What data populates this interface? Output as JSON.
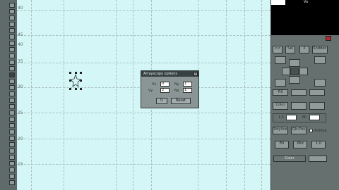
{
  "canvas": {
    "axis_labels": [
      "40",
      "45",
      "40",
      "35",
      "30",
      "25",
      "20",
      "15"
    ]
  },
  "dialog": {
    "title": "Arrayscopy options",
    "close_glyph": "×",
    "fields": [
      {
        "label": "Vx",
        "value": "0"
      },
      {
        "label": "Ny",
        "value": "1"
      },
      {
        "label": "Vy",
        "value": "2"
      },
      {
        "label": "Nx",
        "value": "1"
      }
    ],
    "ok_label": "Ü",
    "cancel_label": "Reset"
  },
  "right_panel": {
    "preview_title": "ᐯᴅ",
    "buttons": {
      "row1": [
        "<<",
        "Sel",
        "X",
        "Snddon"
      ],
      "row_fill": "Fill",
      "row_color": [
        "Color"
      ],
      "labels": [
        "1,5",
        "Mi"
      ],
      "row_opts": [
        "Polyline",
        "Qlc:Pos",
        "Ardline"
      ],
      "row_bottom": [
        "Fill",
        "Wid",
        "1.0"
      ],
      "row_last": [
        "Color"
      ]
    }
  }
}
